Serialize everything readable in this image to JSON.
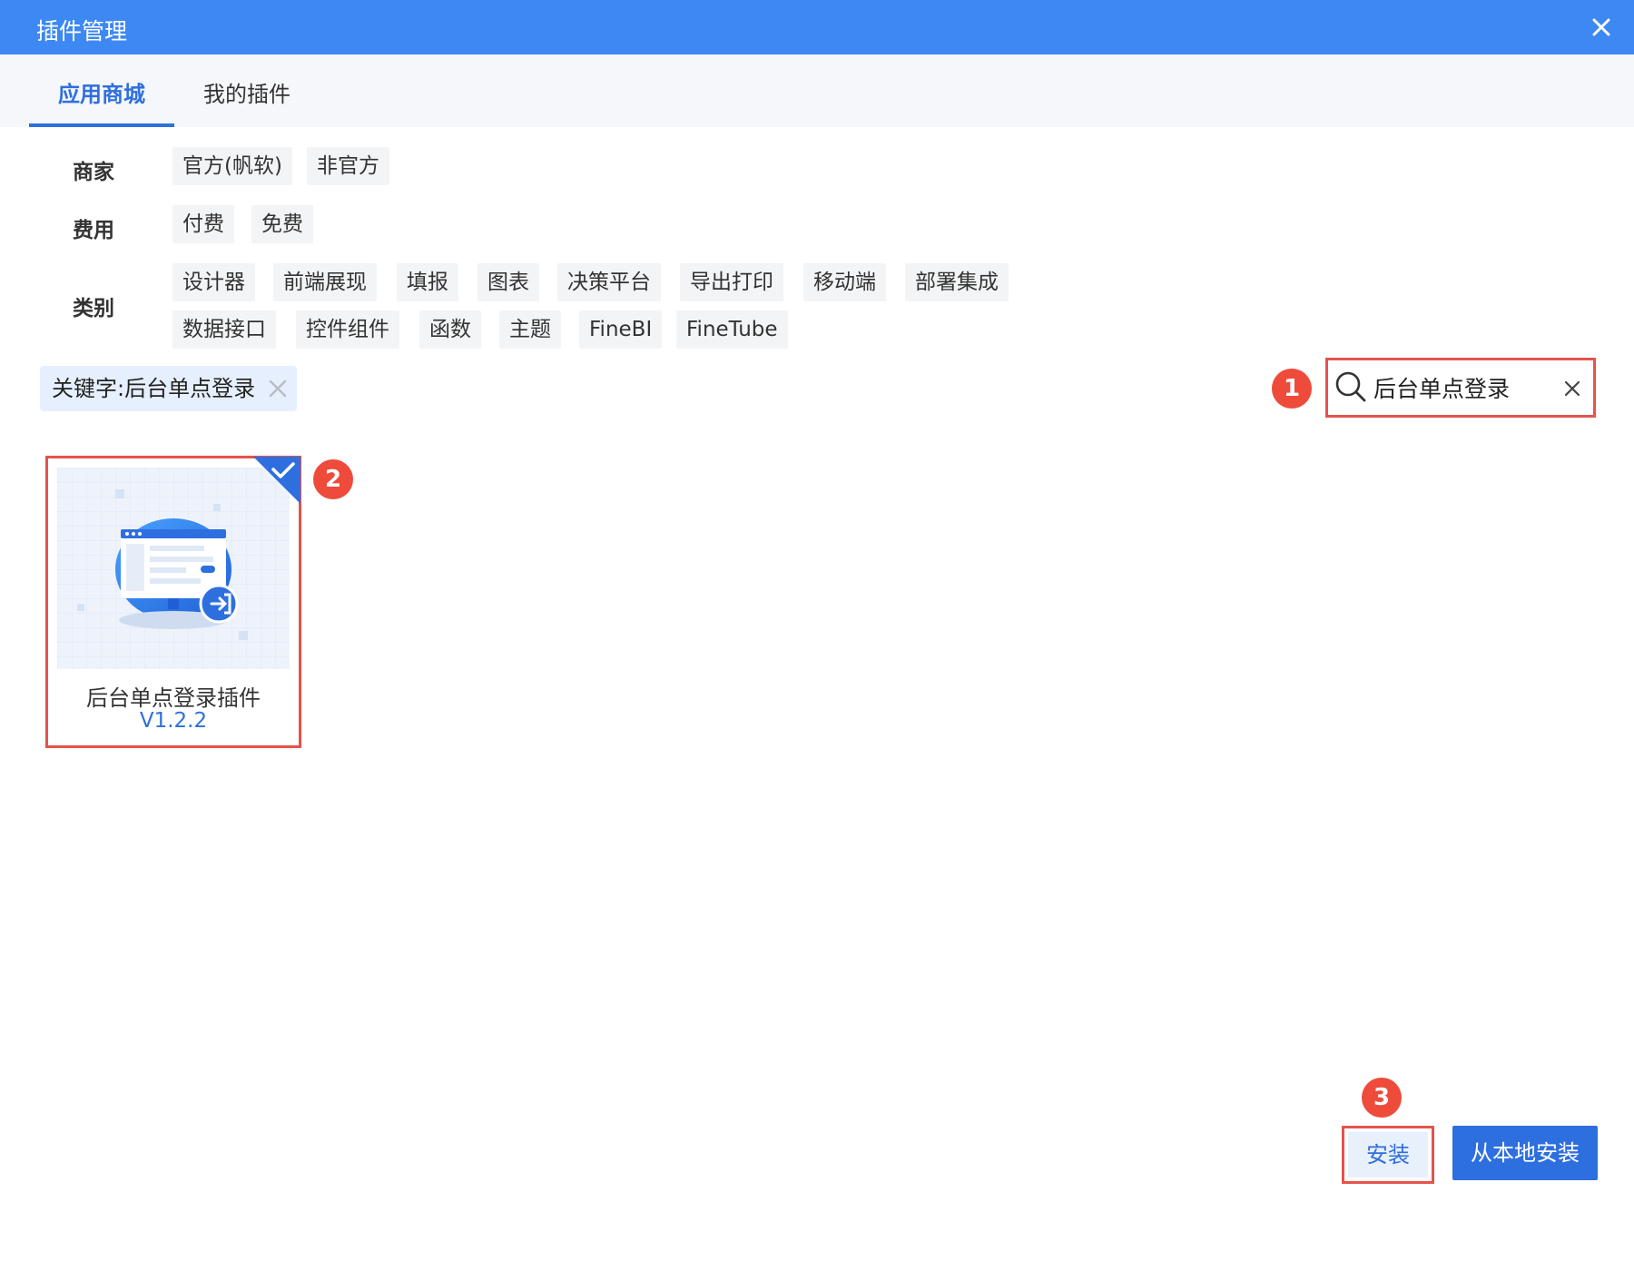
{
  "window": {
    "title": "插件管理",
    "close_icon": "close-icon"
  },
  "tabs": [
    {
      "label": "应用商城",
      "active": true
    },
    {
      "label": "我的插件",
      "active": false
    }
  ],
  "filters": {
    "vendor": {
      "label": "商家",
      "options": [
        "官方(帆软)",
        "非官方"
      ]
    },
    "fee": {
      "label": "费用",
      "options": [
        "付费",
        "免费"
      ]
    },
    "category": {
      "label": "类别",
      "options": [
        "设计器",
        "前端展现",
        "填报",
        "图表",
        "决策平台",
        "导出打印",
        "移动端",
        "部署集成",
        "数据接口",
        "控件组件",
        "函数",
        "主题",
        "FineBI",
        "FineTube"
      ]
    }
  },
  "keyword_tag": {
    "text": "关键字:后台单点登录"
  },
  "search": {
    "value": "后台单点登录",
    "icon": "search-icon"
  },
  "plugins": [
    {
      "name": "后台单点登录插件",
      "version": "V1.2.2",
      "selected": true
    }
  ],
  "actions": {
    "install_label": "安装",
    "local_install_label": "从本地安装"
  },
  "callouts": [
    "1",
    "2",
    "3"
  ],
  "colors": {
    "primary": "#2e6fe0",
    "titlebar": "#3d88f2",
    "highlight": "#e5534b",
    "badge": "#ee4b3b"
  }
}
